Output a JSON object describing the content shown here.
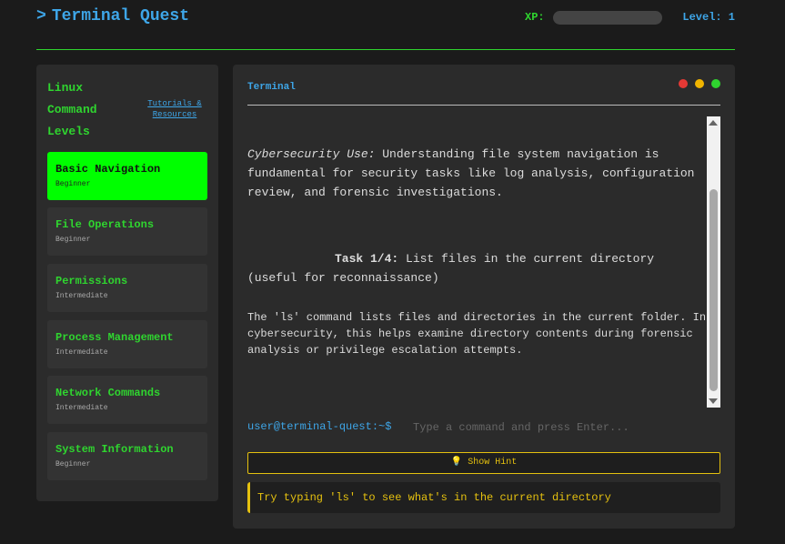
{
  "header": {
    "logo_glyph": ">",
    "title": "Terminal Quest",
    "xp_label": "XP:",
    "xp_progress": 0,
    "level_text": "Level: 1"
  },
  "sidebar": {
    "title": "Linux Command Levels",
    "tutorials_link": "Tutorials & Resources",
    "levels": [
      {
        "name": "Basic Navigation",
        "difficulty": "Beginner",
        "active": true
      },
      {
        "name": "File Operations",
        "difficulty": "Beginner",
        "active": false
      },
      {
        "name": "Permissions",
        "difficulty": "Intermediate",
        "active": false
      },
      {
        "name": "Process Management",
        "difficulty": "Intermediate",
        "active": false
      },
      {
        "name": "Network Commands",
        "difficulty": "Intermediate",
        "active": false
      },
      {
        "name": "System Information",
        "difficulty": "Beginner",
        "active": false
      }
    ]
  },
  "terminal": {
    "title": "Terminal",
    "window_dots": [
      "#e53935",
      "#f0b400",
      "#2fd52f"
    ],
    "cyber_label": "Cybersecurity Use:",
    "cyber_lines": [
      " Understanding file system navigation is",
      "fundamental for security tasks like log analysis, configuration",
      "review, and forensic investigations."
    ],
    "task_label": "Task 1/4:",
    "task_lines": [
      " List files in the current directory",
      "(useful for reconnaissance)"
    ],
    "description_lines": [
      "The 'ls' command lists files and directories in the current folder. In",
      "cybersecurity, this helps examine directory contents during forensic",
      "analysis or privilege escalation attempts."
    ],
    "prompt": "user@terminal-quest:~$",
    "input_placeholder": "Type a command and press Enter...",
    "hint_button": "💡 Show Hint",
    "hint_text": "Try typing 'ls' to see what's in the current directory"
  },
  "colors": {
    "accent_green": "#2fd52f",
    "active_green": "#00ff00",
    "accent_blue": "#3ea6e8",
    "hint_yellow": "#e5c10f"
  }
}
